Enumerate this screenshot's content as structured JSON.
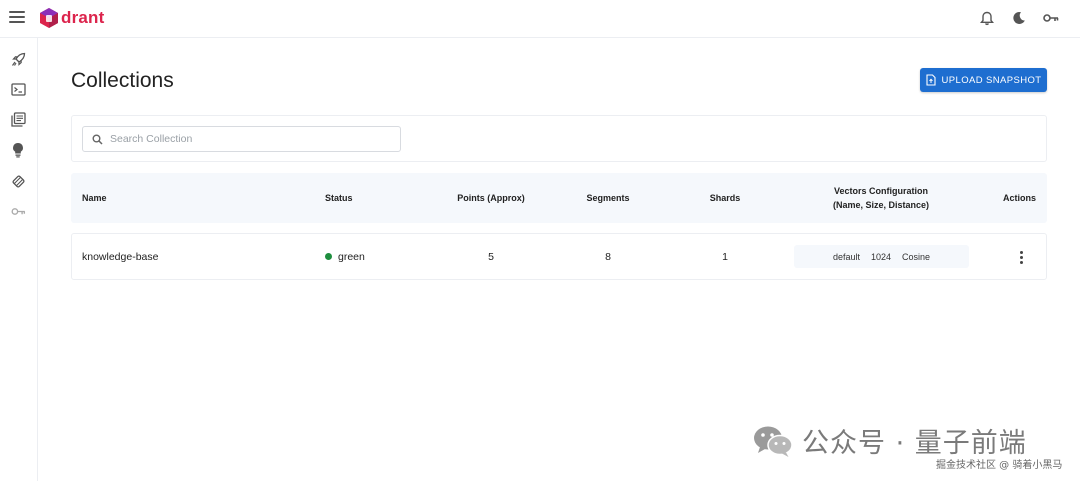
{
  "app": {
    "logo_text": "drant",
    "brand_color": "#dc244c",
    "accent_color": "#1e6ed0"
  },
  "topbar": {
    "icons": [
      "bell-icon",
      "moon-icon",
      "key-icon"
    ]
  },
  "sidebar": {
    "items": [
      {
        "icon": "rocket-icon"
      },
      {
        "icon": "console-icon"
      },
      {
        "icon": "collections-icon"
      },
      {
        "icon": "lightbulb-icon"
      },
      {
        "icon": "datasets-icon"
      },
      {
        "icon": "key-icon"
      }
    ]
  },
  "main": {
    "title": "Collections",
    "upload_button": "UPLOAD SNAPSHOT",
    "search": {
      "placeholder": "Search Collection",
      "value": ""
    },
    "table": {
      "headers": {
        "name": "Name",
        "status": "Status",
        "points": "Points (Approx)",
        "segments": "Segments",
        "shards": "Shards",
        "vectors_line1": "Vectors Configuration",
        "vectors_line2": "(Name, Size, Distance)",
        "actions": "Actions"
      },
      "rows": [
        {
          "name": "knowledge-base",
          "status": "green",
          "status_color": "#1e8e3e",
          "points": "5",
          "segments": "8",
          "shards": "1",
          "vector_name": "default",
          "vector_size": "1024",
          "vector_distance": "Cosine"
        }
      ]
    }
  },
  "watermark": {
    "text": "公众号 · 量子前端",
    "sub": "掘金技术社区 @ 骑着小黑马"
  }
}
